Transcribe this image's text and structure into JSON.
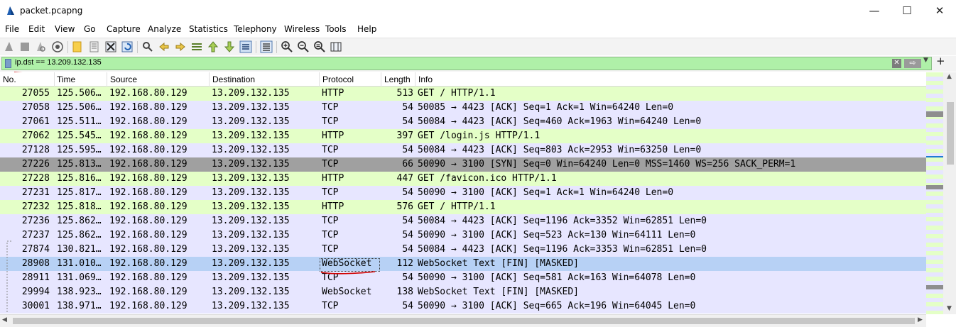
{
  "window": {
    "title": "packet.pcapng",
    "minimize": "—",
    "maximize": "☐",
    "close": "✕"
  },
  "menu": [
    "File",
    "Edit",
    "View",
    "Go",
    "Capture",
    "Analyze",
    "Statistics",
    "Telephony",
    "Wireless",
    "Tools",
    "Help"
  ],
  "filter": {
    "value": "ip.dst == 13.209.132.135",
    "clear_icon": "✕",
    "apply_icon": "⇨",
    "dropdown_icon": "▼",
    "add_icon": "+"
  },
  "columns": [
    "No.",
    "Time",
    "Source",
    "Destination",
    "Protocol",
    "Length",
    "Info"
  ],
  "colors": {
    "http_row": "#e4ffc7",
    "tcp_row": "#e7e6ff",
    "syn_row": "#a0a0a0",
    "selected_row": "#b7d1f5",
    "filter_bg": "#aff0a8",
    "annotation": "#d10000"
  },
  "packets": [
    {
      "no": "27055",
      "time": "125.506…",
      "source": "192.168.80.129",
      "destination": "13.209.132.135",
      "protocol": "HTTP",
      "length": "513",
      "info": "GET / HTTP/1.1",
      "style": "http"
    },
    {
      "no": "27058",
      "time": "125.506…",
      "source": "192.168.80.129",
      "destination": "13.209.132.135",
      "protocol": "TCP",
      "length": "54",
      "info": "50085 → 4423 [ACK] Seq=1 Ack=1 Win=64240 Len=0",
      "style": "tcp"
    },
    {
      "no": "27061",
      "time": "125.511…",
      "source": "192.168.80.129",
      "destination": "13.209.132.135",
      "protocol": "TCP",
      "length": "54",
      "info": "50084 → 4423 [ACK] Seq=460 Ack=1963 Win=64240 Len=0",
      "style": "tcp"
    },
    {
      "no": "27062",
      "time": "125.545…",
      "source": "192.168.80.129",
      "destination": "13.209.132.135",
      "protocol": "HTTP",
      "length": "397",
      "info": "GET /login.js HTTP/1.1",
      "style": "http"
    },
    {
      "no": "27128",
      "time": "125.595…",
      "source": "192.168.80.129",
      "destination": "13.209.132.135",
      "protocol": "TCP",
      "length": "54",
      "info": "50084 → 4423 [ACK] Seq=803 Ack=2953 Win=63250 Len=0",
      "style": "tcp"
    },
    {
      "no": "27226",
      "time": "125.813…",
      "source": "192.168.80.129",
      "destination": "13.209.132.135",
      "protocol": "TCP",
      "length": "66",
      "info": "50090 → 3100 [SYN] Seq=0 Win=64240 Len=0 MSS=1460 WS=256 SACK_PERM=1",
      "style": "syn"
    },
    {
      "no": "27228",
      "time": "125.816…",
      "source": "192.168.80.129",
      "destination": "13.209.132.135",
      "protocol": "HTTP",
      "length": "447",
      "info": "GET /favicon.ico HTTP/1.1",
      "style": "http"
    },
    {
      "no": "27231",
      "time": "125.817…",
      "source": "192.168.80.129",
      "destination": "13.209.132.135",
      "protocol": "TCP",
      "length": "54",
      "info": "50090 → 3100 [ACK] Seq=1 Ack=1 Win=64240 Len=0",
      "style": "tcp"
    },
    {
      "no": "27232",
      "time": "125.818…",
      "source": "192.168.80.129",
      "destination": "13.209.132.135",
      "protocol": "HTTP",
      "length": "576",
      "info": "GET / HTTP/1.1",
      "style": "http"
    },
    {
      "no": "27236",
      "time": "125.862…",
      "source": "192.168.80.129",
      "destination": "13.209.132.135",
      "protocol": "TCP",
      "length": "54",
      "info": "50084 → 4423 [ACK] Seq=1196 Ack=3352 Win=62851 Len=0",
      "style": "tcp"
    },
    {
      "no": "27237",
      "time": "125.862…",
      "source": "192.168.80.129",
      "destination": "13.209.132.135",
      "protocol": "TCP",
      "length": "54",
      "info": "50090 → 3100 [ACK] Seq=523 Ack=130 Win=64111 Len=0",
      "style": "tcp"
    },
    {
      "no": "27874",
      "time": "130.821…",
      "source": "192.168.80.129",
      "destination": "13.209.132.135",
      "protocol": "TCP",
      "length": "54",
      "info": "50084 → 4423 [ACK] Seq=1196 Ack=3353 Win=62851 Len=0",
      "style": "tcp"
    },
    {
      "no": "28908",
      "time": "131.010…",
      "source": "192.168.80.129",
      "destination": "13.209.132.135",
      "protocol": "WebSocket",
      "length": "112",
      "info": "WebSocket Text [FIN] [MASKED]",
      "style": "selected"
    },
    {
      "no": "28911",
      "time": "131.069…",
      "source": "192.168.80.129",
      "destination": "13.209.132.135",
      "protocol": "TCP",
      "length": "54",
      "info": "50090 → 3100 [ACK] Seq=581 Ack=163 Win=64078 Len=0",
      "style": "tcp"
    },
    {
      "no": "29994",
      "time": "138.923…",
      "source": "192.168.80.129",
      "destination": "13.209.132.135",
      "protocol": "WebSocket",
      "length": "138",
      "info": "WebSocket Text [FIN] [MASKED]",
      "style": "tcp"
    },
    {
      "no": "30001",
      "time": "138.971…",
      "source": "192.168.80.129",
      "destination": "13.209.132.135",
      "protocol": "TCP",
      "length": "54",
      "info": "50090 → 3100 [ACK] Seq=665 Ack=196 Win=64045 Len=0",
      "style": "tcp"
    }
  ]
}
